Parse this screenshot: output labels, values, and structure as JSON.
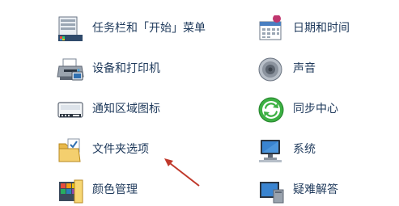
{
  "control_panel": {
    "left_items": [
      {
        "label": "任务栏和「开始」菜单",
        "icon": "taskbar-start-menu-icon"
      },
      {
        "label": "设备和打印机",
        "icon": "printer-icon"
      },
      {
        "label": "通知区域图标",
        "icon": "notification-area-icon"
      },
      {
        "label": "文件夹选项",
        "icon": "folder-options-icon"
      },
      {
        "label": "颜色管理",
        "icon": "color-management-icon"
      }
    ],
    "right_items": [
      {
        "label": "日期和时间",
        "icon": "calendar-clock-icon"
      },
      {
        "label": "声音",
        "icon": "speaker-icon"
      },
      {
        "label": "同步中心",
        "icon": "sync-center-icon"
      },
      {
        "label": "系统",
        "icon": "system-computer-icon"
      },
      {
        "label": "疑难解答",
        "icon": "troubleshooting-icon"
      }
    ]
  },
  "colors": {
    "link_text": "#1e395b",
    "annotation_arrow": "#c0392b"
  }
}
